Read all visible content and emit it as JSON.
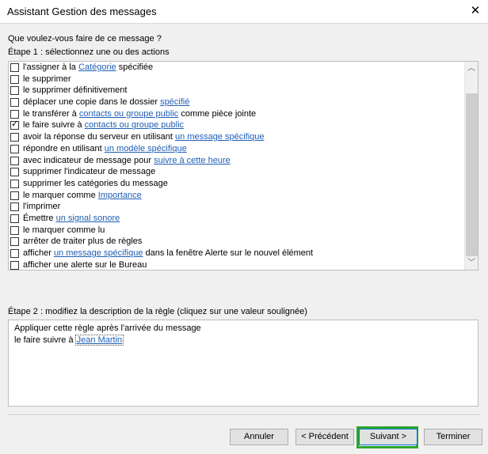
{
  "window": {
    "title": "Assistant Gestion des messages",
    "close_glyph": "✕"
  },
  "question": "Que voulez-vous faire de ce message ?",
  "step1": {
    "pre": "Étape 1 : sélectionnez une ou des actions"
  },
  "actions": [
    {
      "checked": false,
      "before": "l'assigner à la ",
      "link": "Catégorie",
      "after": " spécifiée"
    },
    {
      "checked": false,
      "before": "le supprimer",
      "link": "",
      "after": ""
    },
    {
      "checked": false,
      "before": "le supprimer définitivement",
      "link": "",
      "after": ""
    },
    {
      "checked": false,
      "before": "déplacer une copie dans le dossier ",
      "link": "spécifié",
      "after": ""
    },
    {
      "checked": false,
      "before": "le transférer à ",
      "link": "contacts ou groupe public",
      "after": " comme pièce jointe"
    },
    {
      "checked": true,
      "before": "le faire suivre à ",
      "link": "contacts ou groupe public",
      "after": ""
    },
    {
      "checked": false,
      "before": "avoir la réponse du serveur en utilisant ",
      "link": "un message spécifique",
      "after": ""
    },
    {
      "checked": false,
      "before": "répondre en utilisant ",
      "link": "un modèle spécifique",
      "after": ""
    },
    {
      "checked": false,
      "before": "avec indicateur de message pour ",
      "link": "suivre à cette heure",
      "after": ""
    },
    {
      "checked": false,
      "before": "supprimer l'indicateur de message",
      "link": "",
      "after": ""
    },
    {
      "checked": false,
      "before": "supprimer les catégories du message",
      "link": "",
      "after": ""
    },
    {
      "checked": false,
      "before": "le marquer comme ",
      "link": "Importance",
      "after": ""
    },
    {
      "checked": false,
      "before": "l'imprimer",
      "link": "",
      "after": ""
    },
    {
      "checked": false,
      "before": "Émettre ",
      "link": "un signal sonore",
      "after": ""
    },
    {
      "checked": false,
      "before": "le marquer comme lu",
      "link": "",
      "after": ""
    },
    {
      "checked": false,
      "before": "arrêter de traiter plus de règles",
      "link": "",
      "after": ""
    },
    {
      "checked": false,
      "before": "afficher ",
      "link": "un message spécifique",
      "after": " dans la fenêtre Alerte sur le nouvel élément"
    },
    {
      "checked": false,
      "before": "afficher une alerte sur le Bureau",
      "link": "",
      "after": ""
    }
  ],
  "scrollbar": {
    "up_glyph": "︿",
    "down_glyph": "﹀"
  },
  "step2": {
    "label": "Étape 2 : modifiez la description de la règle (cliquez sur une valeur soulignée)"
  },
  "description": {
    "line1": "Appliquer cette règle après l'arrivée du message",
    "line2_prefix": "le faire suivre à ",
    "line2_link": "Jean Martin"
  },
  "buttons": {
    "cancel": "Annuler",
    "previous": "< Précédent",
    "next": "Suivant >",
    "finish": "Terminer"
  },
  "colors": {
    "link": "#1f5fb6",
    "highlight": "#2fa62c"
  }
}
